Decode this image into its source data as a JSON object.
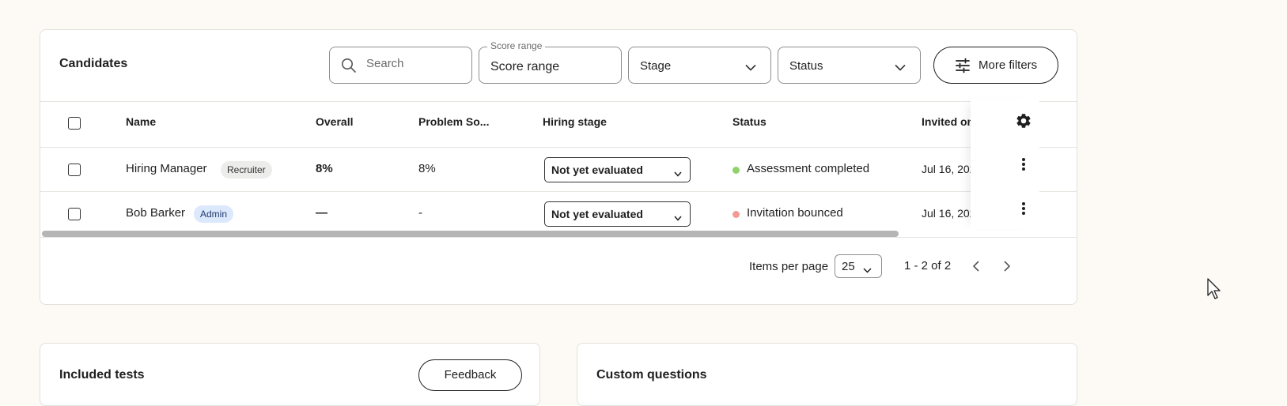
{
  "candidates": {
    "title": "Candidates",
    "search": {
      "placeholder": "Search",
      "icon": "search-icon"
    },
    "score_range": {
      "legend": "Score range",
      "value": "Score range"
    },
    "stage_filter": {
      "value": "Stage"
    },
    "status_filter": {
      "value": "Status"
    },
    "more_filters": {
      "label": "More filters",
      "icon": "sliders-icon"
    },
    "columns": [
      "Name",
      "Overall",
      "Problem So...",
      "Hiring stage",
      "Status",
      "Invited on"
    ],
    "rows": [
      {
        "name": "Hiring Manager",
        "badge": "Recruiter",
        "overall": "8%",
        "problem_solving": "8%",
        "hiring_stage": "Not yet evaluated",
        "status": "Assessment completed",
        "status_color": "#8fd16a",
        "invited_on": "Jul 16, 2024"
      },
      {
        "name": "Bob Barker",
        "badge": "Admin",
        "overall": "—",
        "problem_solving": "-",
        "hiring_stage": "Not yet evaluated",
        "status": "Invitation bounced",
        "status_color": "#f29a94",
        "invited_on": "Jul 16, 2024"
      }
    ],
    "pagination": {
      "items_per_page_label": "Items per page",
      "items_per_page": "25",
      "range": "1 - 2 of 2"
    }
  },
  "included_tests": {
    "title": "Included tests",
    "feedback_label": "Feedback"
  },
  "custom_questions": {
    "title": "Custom questions"
  }
}
